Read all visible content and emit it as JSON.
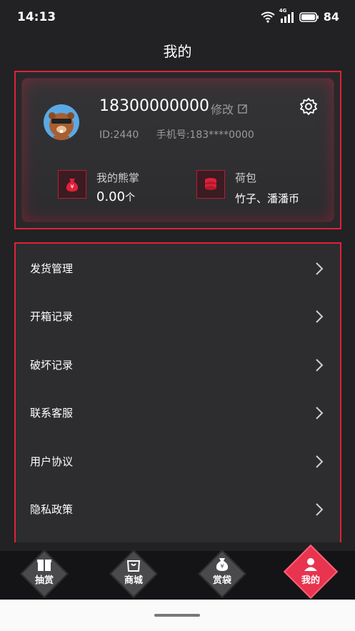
{
  "status": {
    "time": "14:13",
    "network": "4G",
    "battery": "84"
  },
  "header": {
    "title": "我的"
  },
  "profile": {
    "phone": "18300000000",
    "edit_label": "修改",
    "id_text": "ID:2440",
    "mobile_text": "手机号:183****0000",
    "stats": [
      {
        "label": "我的熊掌",
        "value": "0.00",
        "unit": "个"
      },
      {
        "label": "荷包",
        "value": "竹子、潘潘币"
      }
    ]
  },
  "menu": {
    "items": [
      {
        "label": "发货管理"
      },
      {
        "label": "开箱记录"
      },
      {
        "label": "破坏记录"
      },
      {
        "label": "联系客服"
      },
      {
        "label": "用户协议"
      },
      {
        "label": "隐私政策"
      }
    ]
  },
  "tabs": [
    {
      "label": "抽赏",
      "icon": "gift-box-icon"
    },
    {
      "label": "商城",
      "icon": "shopping-bag-icon"
    },
    {
      "label": "赏袋",
      "icon": "money-bag-icon"
    },
    {
      "label": "我的",
      "icon": "user-icon",
      "active": true
    }
  ],
  "colors": {
    "accent": "#e0213a",
    "background": "#222224",
    "active_tab": "#e8344f"
  }
}
